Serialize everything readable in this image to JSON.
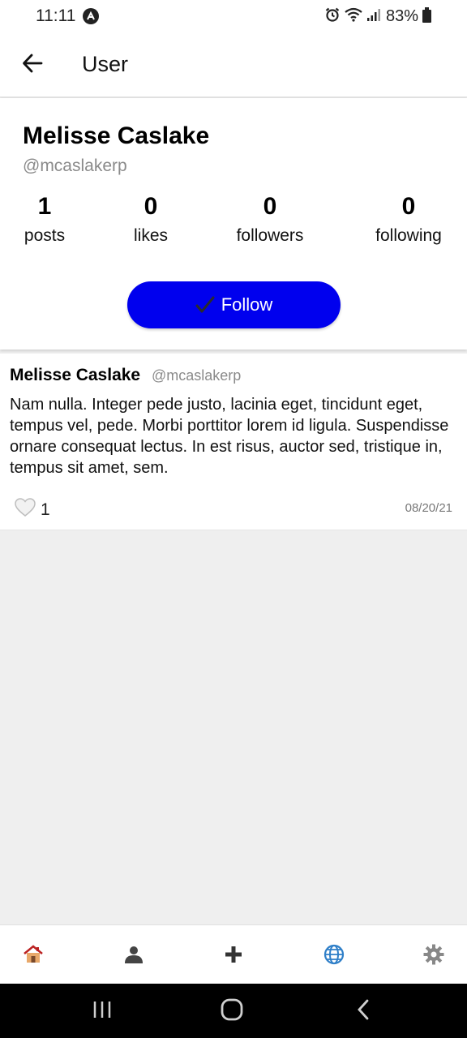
{
  "status_bar": {
    "time": "11:11",
    "battery": "83%"
  },
  "header": {
    "title": "User",
    "back_icon": "arrow-left-icon"
  },
  "profile": {
    "name": "Melisse Caslake",
    "handle": "@mcaslakerp",
    "stats": [
      {
        "value": "1",
        "label": "posts"
      },
      {
        "value": "0",
        "label": "likes"
      },
      {
        "value": "0",
        "label": "followers"
      },
      {
        "value": "0",
        "label": "following"
      }
    ],
    "follow_label": "Follow",
    "follow_icon": "check-icon",
    "accent_color": "#0000ee"
  },
  "post": {
    "author": "Melisse Caslake",
    "handle": "@mcaslakerp",
    "body": "Nam nulla. Integer pede justo, lacinia eget, tincidunt eget, tempus vel, pede. Morbi porttitor lorem id ligula. Suspendisse ornare consequat lectus. In est risus, auctor sed, tristique in, tempus sit amet, sem.",
    "like_icon": "heart-icon",
    "likes": "1",
    "date": "08/20/21"
  },
  "bottom_nav": {
    "items": [
      "home-icon",
      "user-icon",
      "add-icon",
      "globe-icon",
      "settings-icon"
    ]
  },
  "system_nav": {
    "items": [
      "recents-icon",
      "home-circle-icon",
      "back-chevron-icon"
    ]
  }
}
